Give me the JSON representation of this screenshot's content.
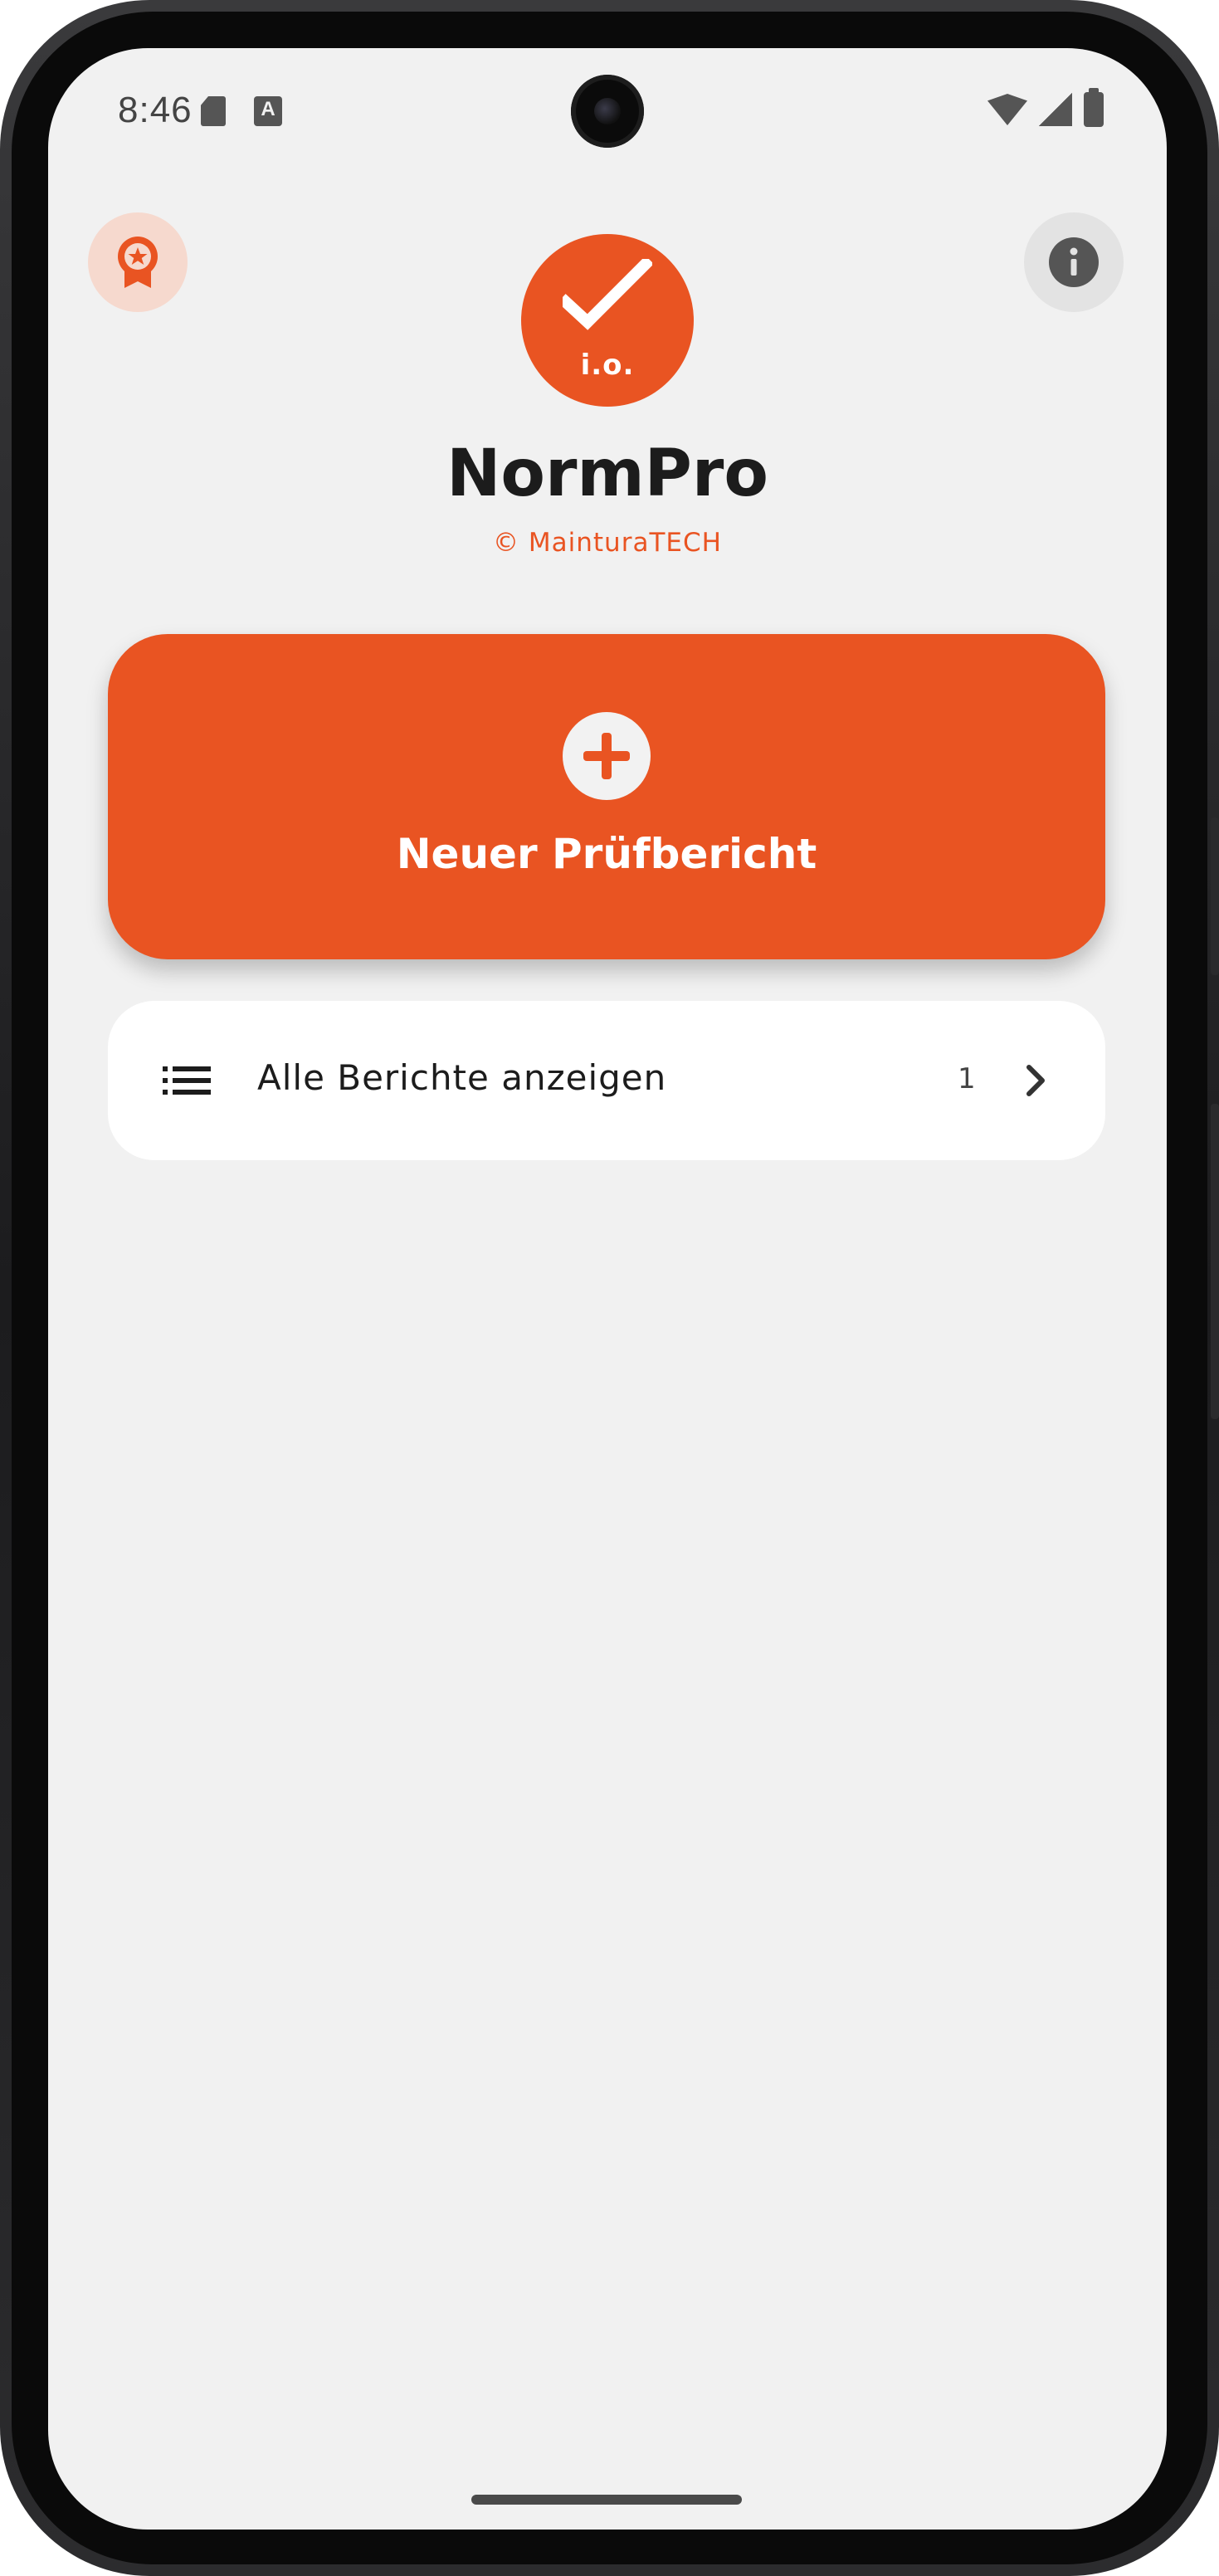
{
  "status_bar": {
    "time": "8:46",
    "notification_icons": [
      "sd-card-icon",
      "translate-icon"
    ],
    "system_icons": [
      "wifi-icon",
      "cell-signal-icon",
      "battery-icon"
    ]
  },
  "header": {
    "left_action_icon": "award-ribbon-icon",
    "right_action_icon": "info-icon",
    "logo_text": "i.o.",
    "app_title": "NormPro",
    "app_subtitle": "© MainturaTECH"
  },
  "actions": {
    "new_report_label": "Neuer Prüfbericht",
    "new_report_icon": "add-circle-icon"
  },
  "reports_row": {
    "icon": "list-icon",
    "label": "Alle Berichte anzeigen",
    "count": "1",
    "trailing_icon": "chevron-right-icon"
  },
  "colors": {
    "accent": "#e95422",
    "background": "#f1f1f1",
    "card": "#ffffff",
    "award_bg": "#f6d9ce",
    "info_bg": "#e3e3e3",
    "text_primary": "#1c1c1c"
  }
}
